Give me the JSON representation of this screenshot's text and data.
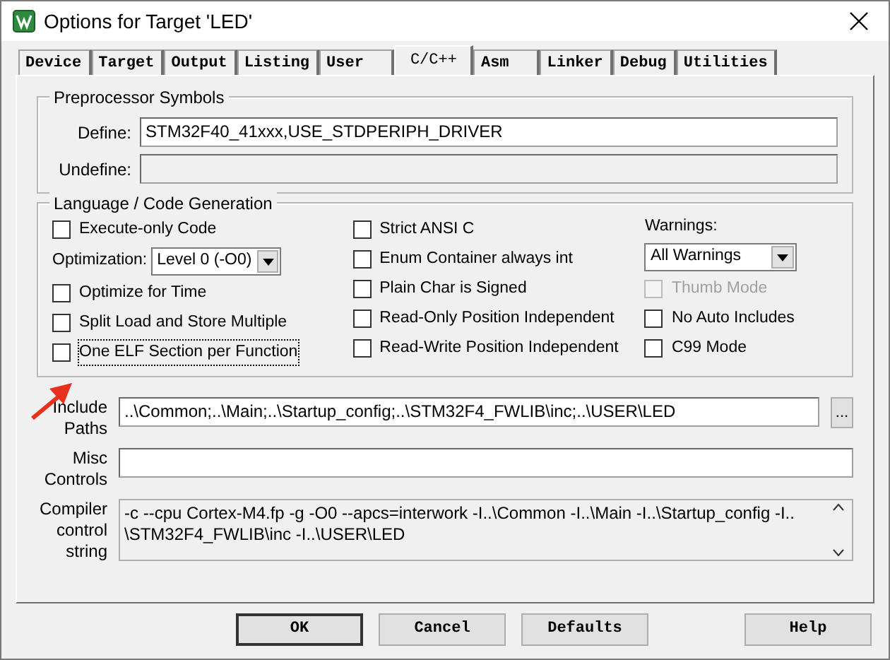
{
  "window": {
    "title": "Options for Target 'LED'"
  },
  "tabs": [
    {
      "label": "Device",
      "selected": false
    },
    {
      "label": "Target",
      "selected": false
    },
    {
      "label": "Output",
      "selected": false
    },
    {
      "label": "Listing",
      "selected": false
    },
    {
      "label": "User",
      "selected": false
    },
    {
      "label": "C/C++",
      "selected": true
    },
    {
      "label": "Asm",
      "selected": false
    },
    {
      "label": "Linker",
      "selected": false
    },
    {
      "label": "Debug",
      "selected": false
    },
    {
      "label": "Utilities",
      "selected": false
    }
  ],
  "preprocessor": {
    "title": "Preprocessor Symbols",
    "define": {
      "label": "Define:",
      "value": "STM32F40_41xxx,USE_STDPERIPH_DRIVER",
      "disabled": false
    },
    "undefine": {
      "label": "Undefine:",
      "disabled": true
    }
  },
  "language": {
    "title": "Language / Code Generation",
    "columns": [
      [
        {
          "kind": "checkbox",
          "label": "Execute-only Code",
          "checked": false,
          "disabled": false,
          "focused": false
        },
        {
          "kind": "select",
          "label": "Optimization:",
          "value": "Level 0 (-O0)"
        },
        {
          "kind": "checkbox",
          "label": "Optimize for Time",
          "checked": false,
          "disabled": false,
          "focused": false
        },
        {
          "kind": "checkbox",
          "label": "Split Load and Store Multiple",
          "checked": false,
          "disabled": false,
          "focused": false
        },
        {
          "kind": "checkbox",
          "label": "One ELF Section per Function",
          "checked": false,
          "disabled": false,
          "focused": true
        }
      ],
      [
        {
          "kind": "checkbox",
          "label": "Strict ANSI C",
          "checked": false,
          "disabled": false,
          "focused": false
        },
        {
          "kind": "checkbox",
          "label": "Enum Container always int",
          "checked": false,
          "disabled": false,
          "focused": false
        },
        {
          "kind": "checkbox",
          "label": "Plain Char is Signed",
          "checked": false,
          "disabled": false,
          "focused": false
        },
        {
          "kind": "checkbox",
          "label": "Read-Only Position Independent",
          "checked": false,
          "disabled": false,
          "focused": false
        },
        {
          "kind": "checkbox",
          "label": "Read-Write Position Independent",
          "checked": false,
          "disabled": false,
          "focused": false
        }
      ],
      [
        {
          "kind": "heading",
          "label": "Warnings:"
        },
        {
          "kind": "select",
          "value": "All Warnings"
        },
        {
          "kind": "checkbox",
          "label": "Thumb Mode",
          "checked": false,
          "disabled": true,
          "focused": false
        },
        {
          "kind": "checkbox",
          "label": "No Auto Includes",
          "checked": false,
          "disabled": false,
          "focused": false
        },
        {
          "kind": "checkbox",
          "label": "C99 Mode",
          "checked": false,
          "disabled": false,
          "focused": false
        }
      ]
    ]
  },
  "include_paths": {
    "label": "Include Paths",
    "value": "..\\Common;..\\Main;..\\Startup_config;..\\STM32F4_FWLIB\\inc;..\\USER\\LED",
    "browse": "..."
  },
  "misc_controls": {
    "label": "Misc Controls"
  },
  "compiler_string": {
    "label": "Compiler control string",
    "value": "-c --cpu Cortex-M4.fp -g -O0 --apcs=interwork -I..\\Common -I..\\Main -I..\\Startup_config -I..\n\\STM32F4_FWLIB\\inc -I..\\USER\\LED"
  },
  "buttons": [
    "OK",
    "Cancel",
    "Defaults",
    "Help"
  ]
}
